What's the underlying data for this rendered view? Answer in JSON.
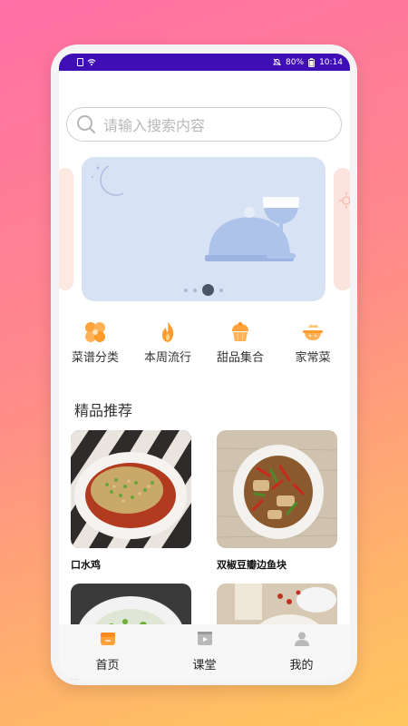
{
  "status_bar": {
    "battery": "80%",
    "time": "10:14"
  },
  "search": {
    "placeholder": "请输入搜索内容"
  },
  "categories": [
    {
      "label": "菜谱分类",
      "icon": "grid-flower-icon"
    },
    {
      "label": "本周流行",
      "icon": "flame-icon"
    },
    {
      "label": "甜品集合",
      "icon": "cupcake-icon"
    },
    {
      "label": "家常菜",
      "icon": "bowl-icon"
    }
  ],
  "section": {
    "title": "精品推荐"
  },
  "recipes": [
    {
      "title": "口水鸡"
    },
    {
      "title": "双椒豆瓣边鱼块"
    },
    {
      "title": ""
    },
    {
      "title": ""
    }
  ],
  "tabs": [
    {
      "label": "首页",
      "icon": "home-icon",
      "active": true
    },
    {
      "label": "课堂",
      "icon": "video-icon",
      "active": false
    },
    {
      "label": "我的",
      "icon": "person-icon",
      "active": false
    }
  ],
  "colors": {
    "accent": "#ff9a3c",
    "status_bar": "#3f0fb5",
    "banner_bg": "#d8e2f5"
  }
}
